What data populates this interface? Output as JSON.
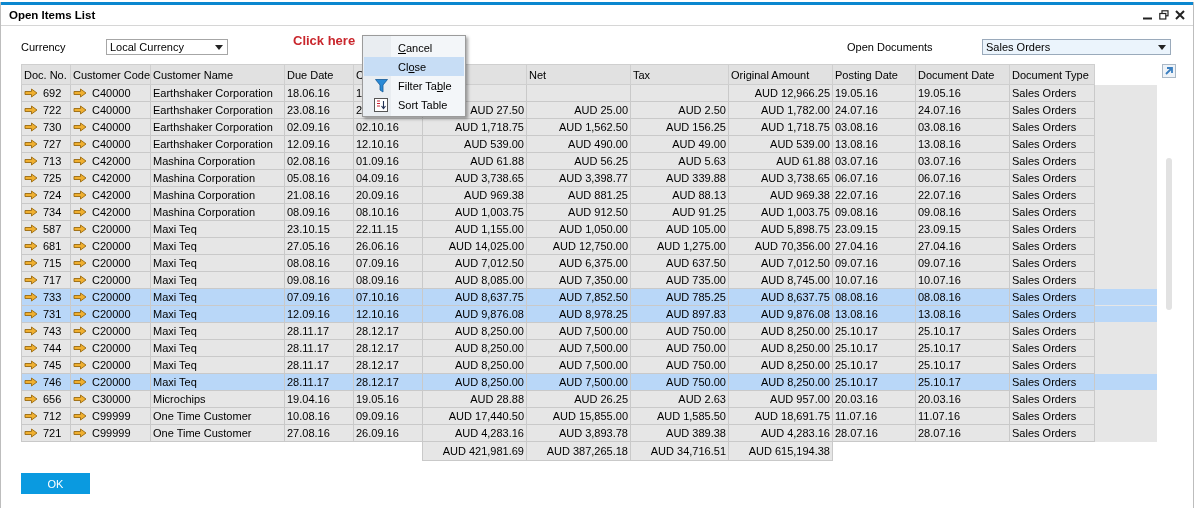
{
  "window": {
    "title": "Open Items List"
  },
  "annotation": {
    "text": "Click here"
  },
  "filters": [
    {
      "label": "Currency",
      "value": "Local Currency",
      "focused": false
    },
    {
      "label": "Open Documents",
      "value": "Sales Orders",
      "focused": true
    }
  ],
  "context_menu": {
    "items": [
      {
        "parts": [
          {
            "text": "C",
            "underlined": true
          },
          {
            "text": "ancel",
            "underlined": false
          }
        ],
        "kind": "plain",
        "selected": false
      },
      {
        "parts": [
          {
            "text": "Cl",
            "underlined": false
          },
          {
            "text": "o",
            "underlined": true
          },
          {
            "text": "se",
            "underlined": false
          }
        ],
        "kind": "plain",
        "selected": true
      },
      {
        "parts": [
          {
            "text": "Filter Ta",
            "underlined": false
          },
          {
            "text": "b",
            "underlined": true
          },
          {
            "text": "le",
            "underlined": false
          }
        ],
        "kind": "filter",
        "selected": false
      },
      {
        "parts": [
          {
            "text": "Sort Table",
            "underlined": false
          }
        ],
        "kind": "sort",
        "selected": false
      }
    ]
  },
  "table": {
    "columns": [
      {
        "label": "Doc. No.",
        "kind": "link"
      },
      {
        "label": "Customer Code",
        "kind": "link"
      },
      {
        "label": "Customer Name",
        "kind": "text"
      },
      {
        "label": "Due Date",
        "kind": "text"
      },
      {
        "label": "C",
        "kind": "text"
      },
      {
        "kind": "amount"
      },
      {
        "label": "Net",
        "kind": "amount"
      },
      {
        "label": "Tax",
        "kind": "amount"
      },
      {
        "label": "Original Amount",
        "kind": "amount"
      },
      {
        "label": "Posting Date",
        "kind": "text"
      },
      {
        "label": "Document Date",
        "kind": "text"
      },
      {
        "label": "Document Type",
        "kind": "text"
      }
    ],
    "rows": [
      {
        "selected": false,
        "cells": [
          "692",
          "C40000",
          "Earthshaker Corporation",
          "18.06.16",
          "1",
          null,
          null,
          null,
          "AUD 12,966.25",
          "19.05.16",
          "19.05.16",
          "Sales Orders"
        ]
      },
      {
        "selected": false,
        "cells": [
          "722",
          "C40000",
          "Earthshaker Corporation",
          "23.08.16",
          "2",
          "AUD 27.50",
          "AUD 25.00",
          "AUD 2.50",
          "AUD 1,782.00",
          "24.07.16",
          "24.07.16",
          "Sales Orders"
        ]
      },
      {
        "selected": false,
        "cells": [
          "730",
          "C40000",
          "Earthshaker Corporation",
          "02.09.16",
          "02.10.16",
          "AUD 1,718.75",
          "AUD 1,562.50",
          "AUD 156.25",
          "AUD 1,718.75",
          "03.08.16",
          "03.08.16",
          "Sales Orders"
        ]
      },
      {
        "selected": false,
        "cells": [
          "727",
          "C40000",
          "Earthshaker Corporation",
          "12.09.16",
          "12.10.16",
          "AUD 539.00",
          "AUD 490.00",
          "AUD 49.00",
          "AUD 539.00",
          "13.08.16",
          "13.08.16",
          "Sales Orders"
        ]
      },
      {
        "selected": false,
        "cells": [
          "713",
          "C42000",
          "Mashina Corporation",
          "02.08.16",
          "01.09.16",
          "AUD 61.88",
          "AUD 56.25",
          "AUD 5.63",
          "AUD 61.88",
          "03.07.16",
          "03.07.16",
          "Sales Orders"
        ]
      },
      {
        "selected": false,
        "cells": [
          "725",
          "C42000",
          "Mashina Corporation",
          "05.08.16",
          "04.09.16",
          "AUD 3,738.65",
          "AUD 3,398.77",
          "AUD 339.88",
          "AUD 3,738.65",
          "06.07.16",
          "06.07.16",
          "Sales Orders"
        ]
      },
      {
        "selected": false,
        "cells": [
          "724",
          "C42000",
          "Mashina Corporation",
          "21.08.16",
          "20.09.16",
          "AUD 969.38",
          "AUD 881.25",
          "AUD 88.13",
          "AUD 969.38",
          "22.07.16",
          "22.07.16",
          "Sales Orders"
        ]
      },
      {
        "selected": false,
        "cells": [
          "734",
          "C42000",
          "Mashina Corporation",
          "08.09.16",
          "08.10.16",
          "AUD 1,003.75",
          "AUD 912.50",
          "AUD 91.25",
          "AUD 1,003.75",
          "09.08.16",
          "09.08.16",
          "Sales Orders"
        ]
      },
      {
        "selected": false,
        "cells": [
          "587",
          "C20000",
          "Maxi Teq",
          "23.10.15",
          "22.11.15",
          "AUD 1,155.00",
          "AUD 1,050.00",
          "AUD 105.00",
          "AUD 5,898.75",
          "23.09.15",
          "23.09.15",
          "Sales Orders"
        ]
      },
      {
        "selected": false,
        "cells": [
          "681",
          "C20000",
          "Maxi Teq",
          "27.05.16",
          "26.06.16",
          "AUD 14,025.00",
          "AUD 12,750.00",
          "AUD 1,275.00",
          "AUD 70,356.00",
          "27.04.16",
          "27.04.16",
          "Sales Orders"
        ]
      },
      {
        "selected": false,
        "cells": [
          "715",
          "C20000",
          "Maxi Teq",
          "08.08.16",
          "07.09.16",
          "AUD 7,012.50",
          "AUD 6,375.00",
          "AUD 637.50",
          "AUD 7,012.50",
          "09.07.16",
          "09.07.16",
          "Sales Orders"
        ]
      },
      {
        "selected": false,
        "cells": [
          "717",
          "C20000",
          "Maxi Teq",
          "09.08.16",
          "08.09.16",
          "AUD 8,085.00",
          "AUD 7,350.00",
          "AUD 735.00",
          "AUD 8,745.00",
          "10.07.16",
          "10.07.16",
          "Sales Orders"
        ]
      },
      {
        "selected": true,
        "cells": [
          "733",
          "C20000",
          "Maxi Teq",
          "07.09.16",
          "07.10.16",
          "AUD 8,637.75",
          "AUD 7,852.50",
          "AUD 785.25",
          "AUD 8,637.75",
          "08.08.16",
          "08.08.16",
          "Sales Orders"
        ]
      },
      {
        "selected": true,
        "cells": [
          "731",
          "C20000",
          "Maxi Teq",
          "12.09.16",
          "12.10.16",
          "AUD 9,876.08",
          "AUD 8,978.25",
          "AUD 897.83",
          "AUD 9,876.08",
          "13.08.16",
          "13.08.16",
          "Sales Orders"
        ]
      },
      {
        "selected": false,
        "cells": [
          "743",
          "C20000",
          "Maxi Teq",
          "28.11.17",
          "28.12.17",
          "AUD 8,250.00",
          "AUD 7,500.00",
          "AUD 750.00",
          "AUD 8,250.00",
          "25.10.17",
          "25.10.17",
          "Sales Orders"
        ]
      },
      {
        "selected": false,
        "cells": [
          "744",
          "C20000",
          "Maxi Teq",
          "28.11.17",
          "28.12.17",
          "AUD 8,250.00",
          "AUD 7,500.00",
          "AUD 750.00",
          "AUD 8,250.00",
          "25.10.17",
          "25.10.17",
          "Sales Orders"
        ]
      },
      {
        "selected": false,
        "cells": [
          "745",
          "C20000",
          "Maxi Teq",
          "28.11.17",
          "28.12.17",
          "AUD 8,250.00",
          "AUD 7,500.00",
          "AUD 750.00",
          "AUD 8,250.00",
          "25.10.17",
          "25.10.17",
          "Sales Orders"
        ]
      },
      {
        "selected": true,
        "cells": [
          "746",
          "C20000",
          "Maxi Teq",
          "28.11.17",
          "28.12.17",
          "AUD 8,250.00",
          "AUD 7,500.00",
          "AUD 750.00",
          "AUD 8,250.00",
          "25.10.17",
          "25.10.17",
          "Sales Orders"
        ]
      },
      {
        "selected": false,
        "cells": [
          "656",
          "C30000",
          "Microchips",
          "19.04.16",
          "19.05.16",
          "AUD 28.88",
          "AUD 26.25",
          "AUD 2.63",
          "AUD 957.00",
          "20.03.16",
          "20.03.16",
          "Sales Orders"
        ]
      },
      {
        "selected": false,
        "cells": [
          "712",
          "C99999",
          "One Time Customer",
          "10.08.16",
          "09.09.16",
          "AUD 17,440.50",
          "AUD 15,855.00",
          "AUD 1,585.50",
          "AUD 18,691.75",
          "11.07.16",
          "11.07.16",
          "Sales Orders"
        ]
      },
      {
        "selected": false,
        "cells": [
          "721",
          "C99999",
          "One Time Customer",
          "27.08.16",
          "26.09.16",
          "AUD 4,283.16",
          "AUD 3,893.78",
          "AUD 389.38",
          "AUD 4,283.16",
          "28.07.16",
          "28.07.16",
          "Sales Orders"
        ]
      }
    ],
    "totals": [
      "AUD 421,981.69",
      "AUD 387,265.18",
      "AUD 34,716.51",
      "AUD 615,194.38"
    ]
  },
  "buttons": [
    {
      "label": "OK"
    }
  ]
}
